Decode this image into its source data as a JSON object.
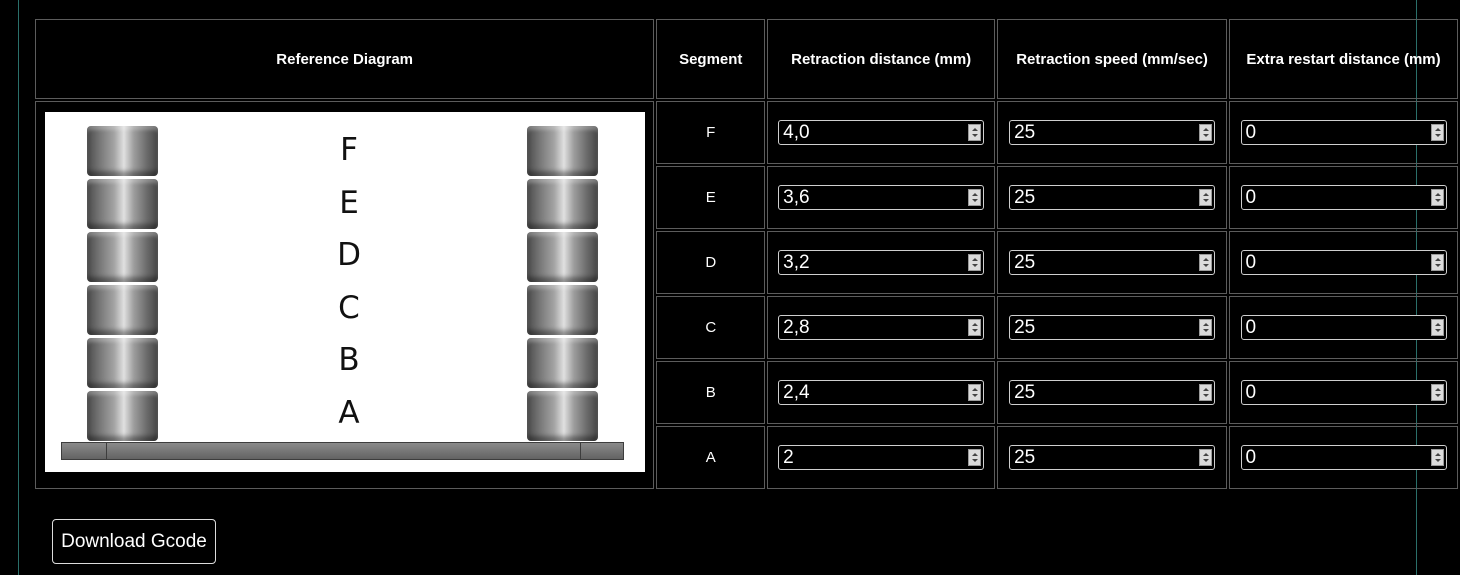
{
  "headers": {
    "diagram": "Reference Diagram",
    "segment": "Segment",
    "distance": "Retraction distance (mm)",
    "speed": "Retraction speed (mm/sec)",
    "extra": "Extra restart distance (mm)"
  },
  "diagram_letters": [
    "F",
    "E",
    "D",
    "C",
    "B",
    "A"
  ],
  "rows": [
    {
      "segment": "F",
      "distance": "4,0",
      "speed": "25",
      "extra": "0"
    },
    {
      "segment": "E",
      "distance": "3,6",
      "speed": "25",
      "extra": "0"
    },
    {
      "segment": "D",
      "distance": "3,2",
      "speed": "25",
      "extra": "0"
    },
    {
      "segment": "C",
      "distance": "2,8",
      "speed": "25",
      "extra": "0"
    },
    {
      "segment": "B",
      "distance": "2,4",
      "speed": "25",
      "extra": "0"
    },
    {
      "segment": "A",
      "distance": "2",
      "speed": "25",
      "extra": "0"
    }
  ],
  "download_button": "Download Gcode",
  "colors": {
    "background": "#000000",
    "border": "#5c5c5c",
    "guide_line": "#2a6f6a"
  }
}
